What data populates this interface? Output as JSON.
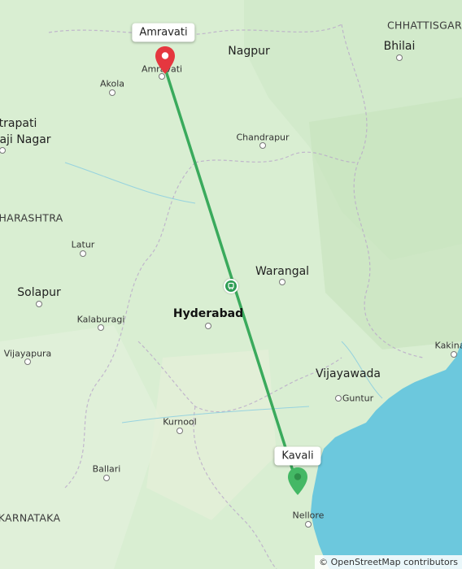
{
  "map": {
    "labels": {
      "chhattisgarh": "CHHATTISGAR",
      "bhilai": "Bhilai",
      "nagpur": "Nagpur",
      "amravati_place": "Amravati",
      "akola": "Akola",
      "chhatrapati_1": "trapati",
      "chhatrapati_2": "aji Nagar",
      "chandrapur": "Chandrapur",
      "maharashtra": "HARASHTRA",
      "latur": "Latur",
      "warangal": "Warangal",
      "solapur": "Solapur",
      "hyderabad": "Hyderabad",
      "kalaburagi": "Kalaburagi",
      "vijayapura": "Vijayapura",
      "kakinada": "Kakina",
      "vijayawada": "Vijayawada",
      "guntur": "Guntur",
      "kurnool": "Kurnool",
      "ballari": "Ballari",
      "karnataka": "KARNATAKA",
      "nellore": "Nellore"
    },
    "origin_tag": "Amravati",
    "destination_tag": "Kavali",
    "colors": {
      "land": "#dcefd6",
      "sea": "#6cc8dd",
      "route": "#3aaa5c",
      "origin_pin": "#e5373f",
      "destination_pin": "#44b865"
    },
    "attribution": "© OpenStreetMap contributors"
  }
}
